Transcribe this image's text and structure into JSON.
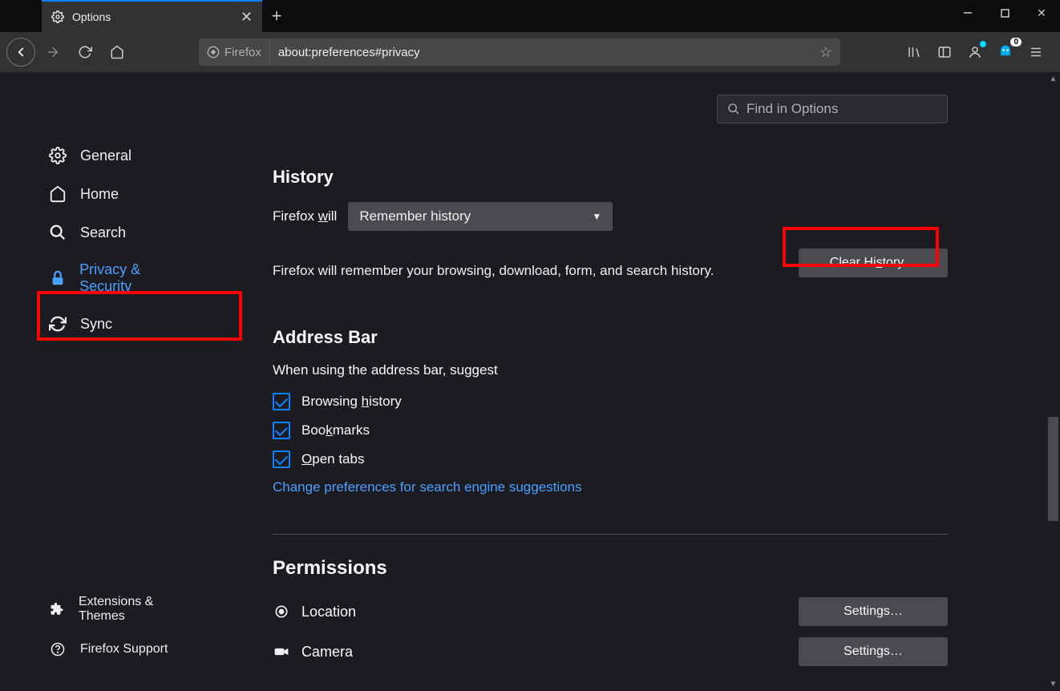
{
  "titlebar": {
    "tab_title": "Options",
    "newtab": "+"
  },
  "navbar": {
    "identity_label": "Firefox",
    "url": "about:preferences#privacy"
  },
  "ghost_badge": "0",
  "search": {
    "placeholder": "Find in Options"
  },
  "sidebar": {
    "general": "General",
    "home": "Home",
    "search": "Search",
    "privacy": "Privacy & Security",
    "sync": "Sync",
    "extensions": "Extensions & Themes",
    "support": "Firefox Support"
  },
  "history": {
    "heading": "History",
    "will_prefix": "Firefox ",
    "will_u": "w",
    "will_suffix": "ill",
    "select_value": "Remember history",
    "desc": "Firefox will remember your browsing, download, form, and search history.",
    "clear_prefix": "Clear Hi",
    "clear_u": "s",
    "clear_suffix": "tory…"
  },
  "addressbar": {
    "heading": "Address Bar",
    "subheading": "When using the address bar, suggest",
    "cb1_prefix": "Browsing ",
    "cb1_u": "h",
    "cb1_suffix": "istory",
    "cb2_prefix": "Boo",
    "cb2_u": "k",
    "cb2_suffix": "marks",
    "cb3_u": "O",
    "cb3_suffix": "pen tabs",
    "link": "Change preferences for search engine suggestions"
  },
  "permissions": {
    "heading": "Permissions",
    "location": "Location",
    "camera": "Camera",
    "settings_btn": "Settings…"
  }
}
